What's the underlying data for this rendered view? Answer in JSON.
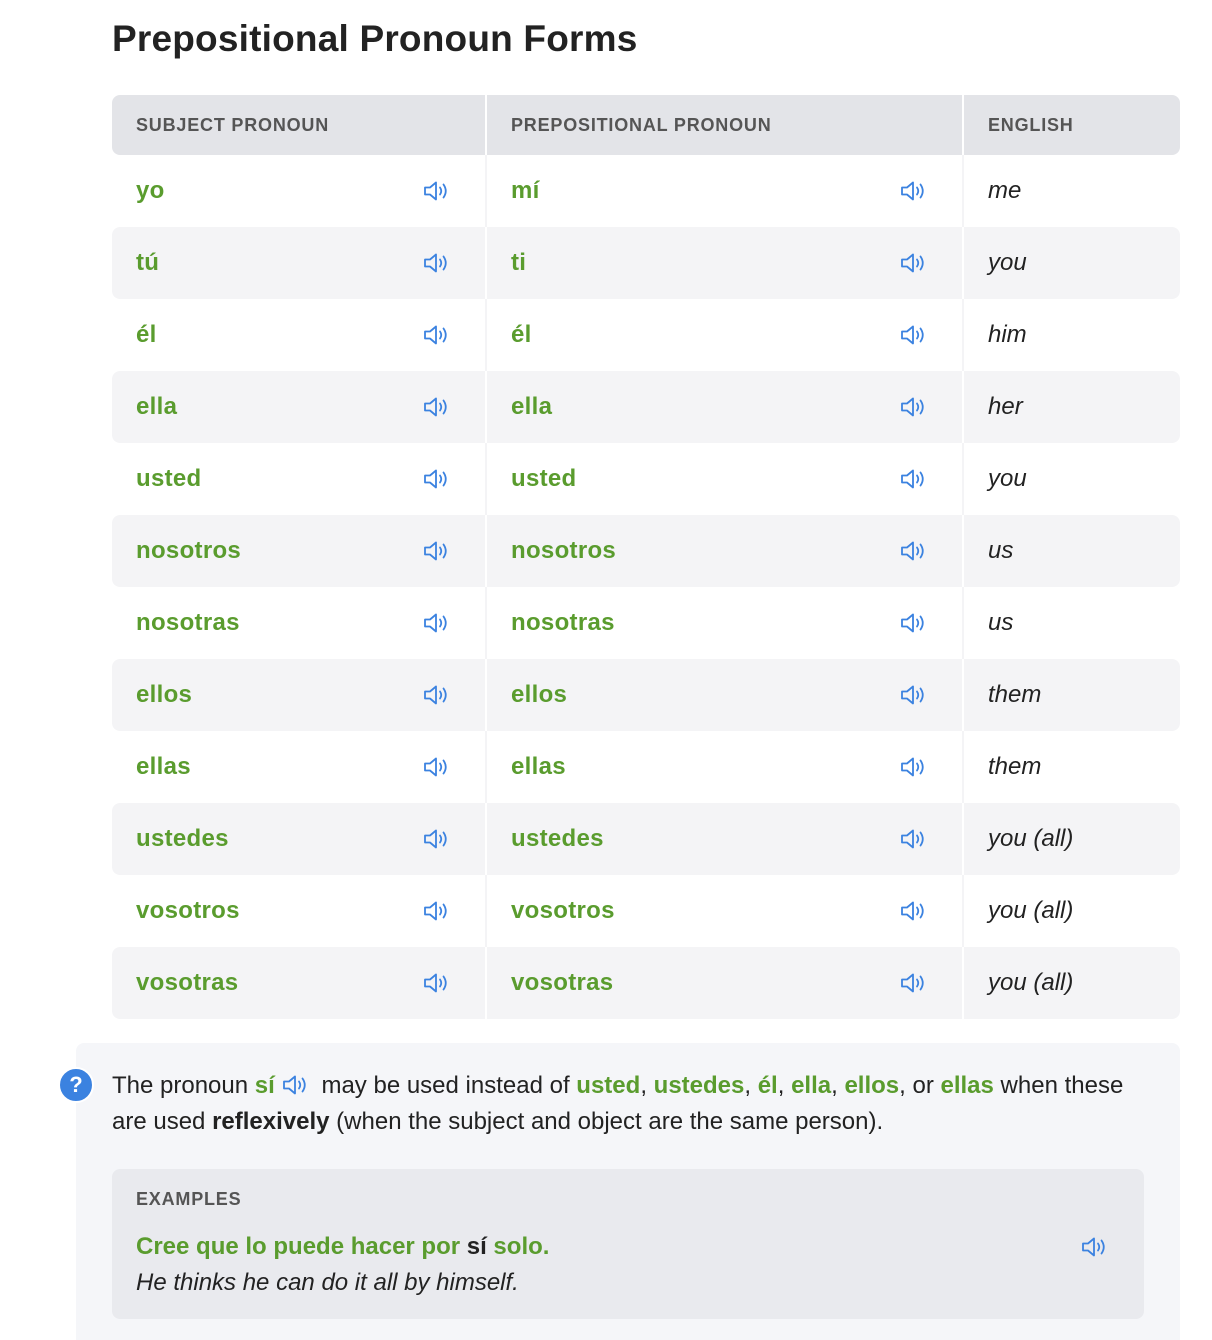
{
  "page_title": "Prepositional Pronoun Forms",
  "table": {
    "headers": [
      "SUBJECT PRONOUN",
      "PREPOSITIONAL PRONOUN",
      "ENGLISH"
    ],
    "rows": [
      {
        "subject": "yo",
        "prepositional": "mí",
        "english": "me"
      },
      {
        "subject": "tú",
        "prepositional": "ti",
        "english": "you"
      },
      {
        "subject": "él",
        "prepositional": "él",
        "english": "him"
      },
      {
        "subject": "ella",
        "prepositional": "ella",
        "english": "her"
      },
      {
        "subject": "usted",
        "prepositional": "usted",
        "english": "you"
      },
      {
        "subject": "nosotros",
        "prepositional": "nosotros",
        "english": "us"
      },
      {
        "subject": "nosotras",
        "prepositional": "nosotras",
        "english": "us"
      },
      {
        "subject": "ellos",
        "prepositional": "ellos",
        "english": "them"
      },
      {
        "subject": "ellas",
        "prepositional": "ellas",
        "english": "them"
      },
      {
        "subject": "ustedes",
        "prepositional": "ustedes",
        "english": "you (all)"
      },
      {
        "subject": "vosotros",
        "prepositional": "vosotros",
        "english": "you (all)"
      },
      {
        "subject": "vosotras",
        "prepositional": "vosotras",
        "english": "you (all)"
      }
    ]
  },
  "note": {
    "help_symbol": "?",
    "text_1": "The pronoun ",
    "si": "sí",
    "text_2": " may be used instead of ",
    "usted": "usted",
    "comma_1": ", ",
    "ustedes": "ustedes",
    "comma_2": ", ",
    "el": "él",
    "comma_3": ", ",
    "ella": "ella",
    "comma_4": ", ",
    "ellos": "ellos",
    "or": ", or ",
    "ellas": "ellas",
    "text_3": " when these are used ",
    "reflexively": "reflexively",
    "text_4": " (when the subject and object are the same person)."
  },
  "examples": {
    "label": "EXAMPLES",
    "sentence_before": "Cree que lo puede hacer por ",
    "sentence_highlight": "sí",
    "sentence_after": " solo.",
    "translation": "He thinks he can do it all by himself."
  },
  "colors": {
    "spanish_green": "#5a9c2e",
    "speaker_blue": "#3b82e0",
    "header_bg": "#e3e4e8",
    "stripe_bg": "#f4f4f6"
  },
  "icons": {
    "speaker": "speaker-icon",
    "help": "question-circle-icon"
  }
}
